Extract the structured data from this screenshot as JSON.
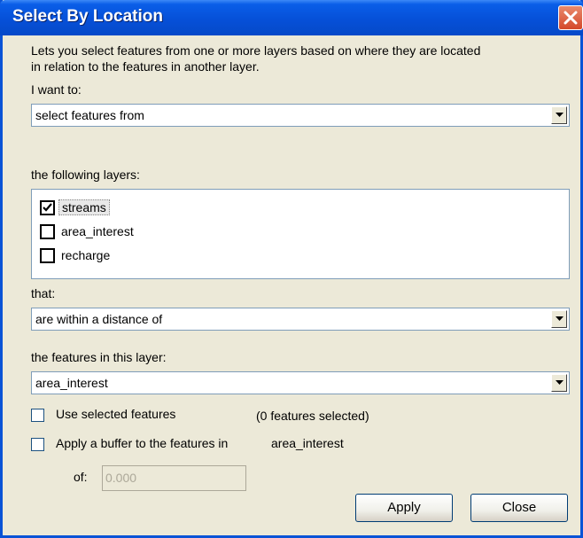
{
  "window": {
    "title": "Select By Location"
  },
  "description": {
    "line1": "Lets you select features from one or more layers based on where they are located",
    "line2": "in relation to the features in another layer."
  },
  "method": {
    "label": "I want to:",
    "value": "select features from"
  },
  "layers": {
    "label": "the following layers:",
    "items": [
      {
        "label": "streams",
        "checked": true
      },
      {
        "label": "area_interest",
        "checked": false
      },
      {
        "label": "recharge",
        "checked": false
      }
    ]
  },
  "relation": {
    "label": "that:",
    "value": "are within a distance of"
  },
  "source_layer": {
    "label": "the features in this layer:",
    "value": "area_interest"
  },
  "options": {
    "use_selected_label": "Use selected features",
    "selected_count": "(0 features selected)",
    "buffer_label": "Apply a buffer to the features in",
    "buffer_layer": "area_interest",
    "of_label": "of:",
    "buffer_value": "0.000"
  },
  "buttons": {
    "apply": "Apply",
    "close": "Close"
  },
  "icons": {
    "close": "close-icon",
    "dropdown": "chevron-down-icon",
    "check": "checkmark-icon"
  }
}
